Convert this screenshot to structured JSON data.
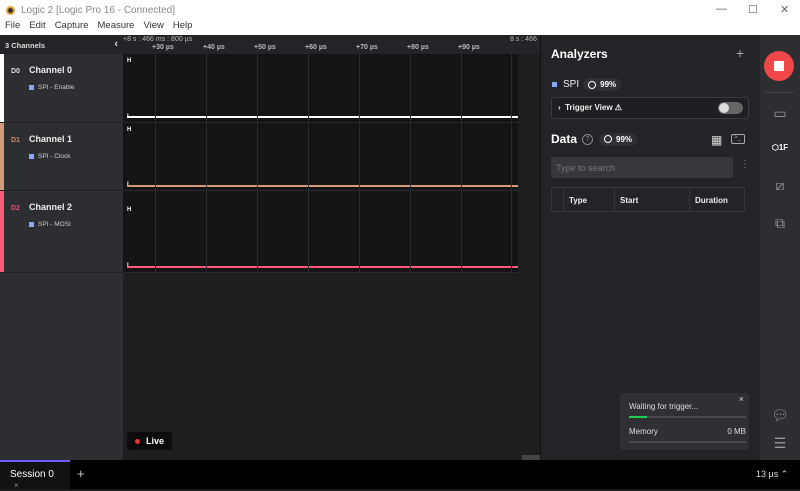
{
  "window": {
    "title": "Logic 2 [Logic Pro 16 - Connected]",
    "minimize": "—",
    "maximize": "☐",
    "close": "✕"
  },
  "menu": [
    "File",
    "Edit",
    "Capture",
    "Measure",
    "View",
    "Help"
  ],
  "channels_header": "3 Channels",
  "channels": [
    {
      "id": "D0",
      "name": "Channel 0",
      "analyzer": "SPI - Enable",
      "color": "#ffffff",
      "idcolor": "#dddddd"
    },
    {
      "id": "D1",
      "name": "Channel 1",
      "analyzer": "SPI - Clock",
      "color": "#d49a7a",
      "idcolor": "#c98a6a"
    },
    {
      "id": "D2",
      "name": "Channel 2",
      "analyzer": "SPI - MOSI",
      "color": "#ff5c7c",
      "idcolor": "#e0506e"
    }
  ],
  "timeline": {
    "start": "+8 s : 466 ms : 800 µs",
    "end": "8 s : 466",
    "ticks": [
      "+30 µs",
      "+40 µs",
      "+50 µs",
      "+60 µs",
      "+70 µs",
      "+80 µs",
      "+90 µs"
    ]
  },
  "levels": {
    "high": "H",
    "low": "L"
  },
  "live": "Live",
  "analyzers": {
    "title": "Analyzers",
    "add": "+",
    "name": "SPI",
    "progress": "99%",
    "trigger_view": "Trigger View ⚠",
    "trigger_enabled": false
  },
  "data": {
    "title": "Data",
    "progress": "99%",
    "search_placeholder": "Type to search",
    "columns": [
      "Type",
      "Start",
      "Duration"
    ]
  },
  "status": {
    "waiting": "Waiting for trigger...",
    "waiting_progress": 15,
    "memory_label": "Memory",
    "memory_value": "0 MB",
    "close": "×"
  },
  "session": {
    "label": "Session 0",
    "close": "×",
    "add": "+"
  },
  "timescale": "13 µs ⌃",
  "colors": {
    "accent": "#6f5cff",
    "record": "#f04848",
    "progress": "#22cc55"
  }
}
